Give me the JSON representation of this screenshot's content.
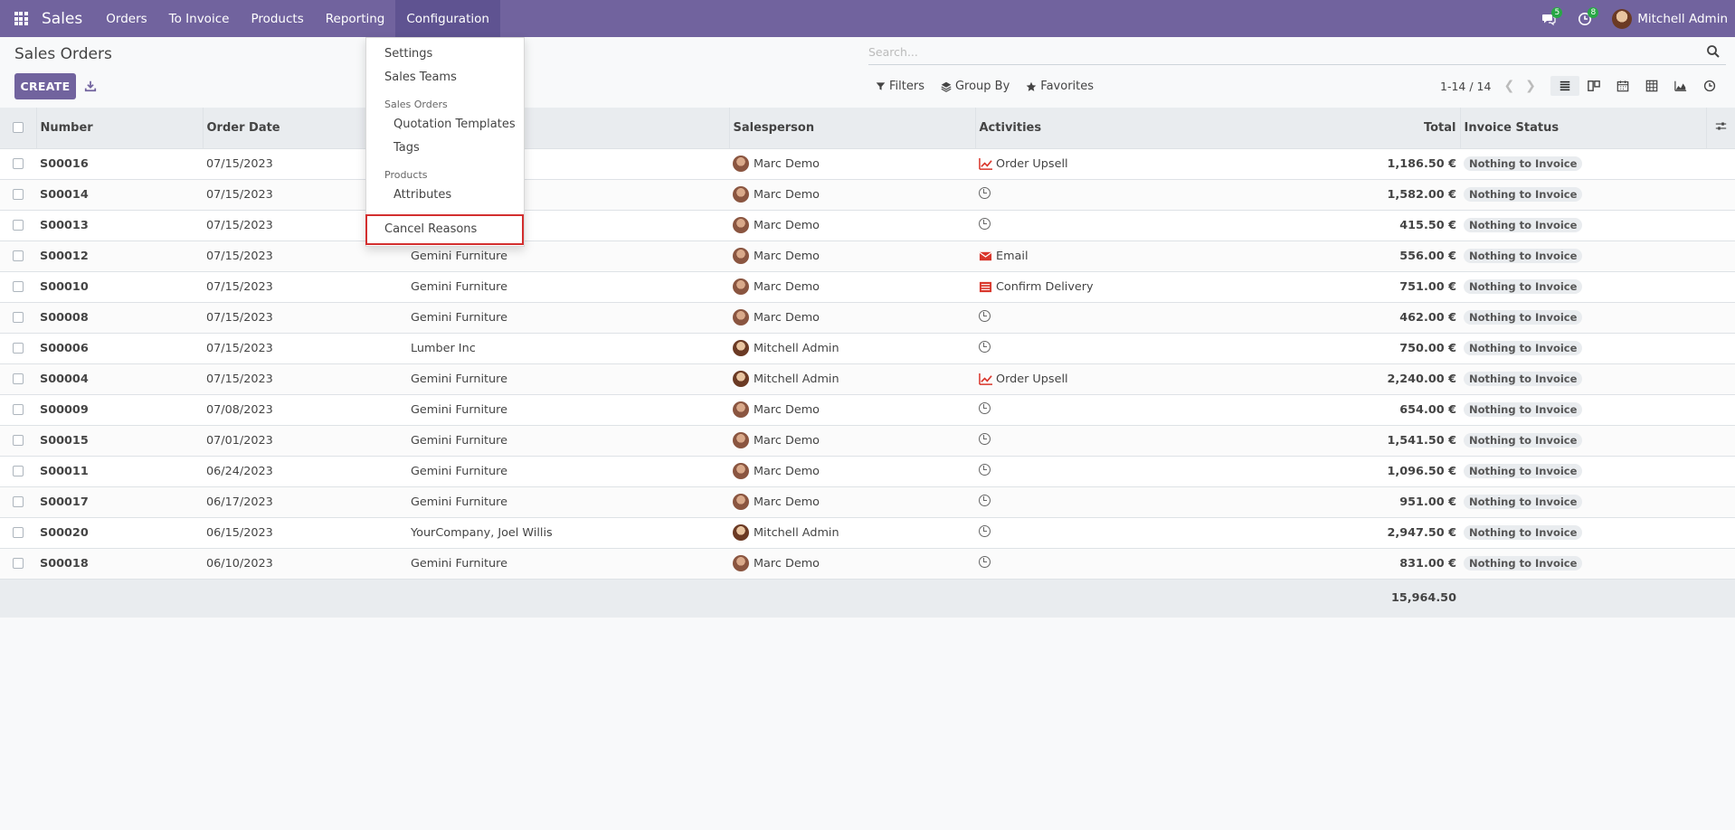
{
  "navbar": {
    "brand": "Sales",
    "menu": [
      "Orders",
      "To Invoice",
      "Products",
      "Reporting",
      "Configuration"
    ],
    "messages_count": "5",
    "activities_count": "8",
    "user_name": "Mitchell Admin"
  },
  "control_panel": {
    "title": "Sales Orders",
    "create_label": "CREATE",
    "search_placeholder": "Search...",
    "filters_label": "Filters",
    "groupby_label": "Group By",
    "favorites_label": "Favorites",
    "pager": "1-14 / 14"
  },
  "config_menu": {
    "settings": "Settings",
    "sales_teams": "Sales Teams",
    "sales_orders_header": "Sales Orders",
    "quotation_templates": "Quotation Templates",
    "tags": "Tags",
    "products_header": "Products",
    "attributes": "Attributes",
    "cancel_reasons": "Cancel Reasons"
  },
  "table": {
    "headers": {
      "number": "Number",
      "order_date": "Order Date",
      "customer": "",
      "salesperson": "Salesperson",
      "activities": "Activities",
      "total": "Total",
      "invoice_status": "Invoice Status"
    },
    "rows": [
      {
        "number": "S00016",
        "date": "07/15/2023",
        "customer": "",
        "salesperson": "Marc Demo",
        "activity": "Order Upsell",
        "activity_type": "upsell",
        "total": "1,186.50 €",
        "status": "Nothing to Invoice"
      },
      {
        "number": "S00014",
        "date": "07/15/2023",
        "customer": "",
        "salesperson": "Marc Demo",
        "activity": "",
        "activity_type": "clock",
        "total": "1,582.00 €",
        "status": "Nothing to Invoice"
      },
      {
        "number": "S00013",
        "date": "07/15/2023",
        "customer": "",
        "salesperson": "Marc Demo",
        "activity": "",
        "activity_type": "clock",
        "total": "415.50 €",
        "status": "Nothing to Invoice"
      },
      {
        "number": "S00012",
        "date": "07/15/2023",
        "customer": "Gemini Furniture",
        "salesperson": "Marc Demo",
        "activity": "Email",
        "activity_type": "email",
        "total": "556.00 €",
        "status": "Nothing to Invoice"
      },
      {
        "number": "S00010",
        "date": "07/15/2023",
        "customer": "Gemini Furniture",
        "salesperson": "Marc Demo",
        "activity": "Confirm Delivery",
        "activity_type": "delivery",
        "total": "751.00 €",
        "status": "Nothing to Invoice"
      },
      {
        "number": "S00008",
        "date": "07/15/2023",
        "customer": "Gemini Furniture",
        "salesperson": "Marc Demo",
        "activity": "",
        "activity_type": "clock",
        "total": "462.00 €",
        "status": "Nothing to Invoice"
      },
      {
        "number": "S00006",
        "date": "07/15/2023",
        "customer": "Lumber Inc",
        "salesperson": "Mitchell Admin",
        "activity": "",
        "activity_type": "clock",
        "total": "750.00 €",
        "status": "Nothing to Invoice"
      },
      {
        "number": "S00004",
        "date": "07/15/2023",
        "customer": "Gemini Furniture",
        "salesperson": "Mitchell Admin",
        "activity": "Order Upsell",
        "activity_type": "upsell",
        "total": "2,240.00 €",
        "status": "Nothing to Invoice"
      },
      {
        "number": "S00009",
        "date": "07/08/2023",
        "customer": "Gemini Furniture",
        "salesperson": "Marc Demo",
        "activity": "",
        "activity_type": "clock",
        "total": "654.00 €",
        "status": "Nothing to Invoice"
      },
      {
        "number": "S00015",
        "date": "07/01/2023",
        "customer": "Gemini Furniture",
        "salesperson": "Marc Demo",
        "activity": "",
        "activity_type": "clock",
        "total": "1,541.50 €",
        "status": "Nothing to Invoice"
      },
      {
        "number": "S00011",
        "date": "06/24/2023",
        "customer": "Gemini Furniture",
        "salesperson": "Marc Demo",
        "activity": "",
        "activity_type": "clock",
        "total": "1,096.50 €",
        "status": "Nothing to Invoice"
      },
      {
        "number": "S00017",
        "date": "06/17/2023",
        "customer": "Gemini Furniture",
        "salesperson": "Marc Demo",
        "activity": "",
        "activity_type": "clock",
        "total": "951.00 €",
        "status": "Nothing to Invoice"
      },
      {
        "number": "S00020",
        "date": "06/15/2023",
        "customer": "YourCompany, Joel Willis",
        "salesperson": "Mitchell Admin",
        "activity": "",
        "activity_type": "clock",
        "total": "2,947.50 €",
        "status": "Nothing to Invoice"
      },
      {
        "number": "S00018",
        "date": "06/10/2023",
        "customer": "Gemini Furniture",
        "salesperson": "Marc Demo",
        "activity": "",
        "activity_type": "clock",
        "total": "831.00 €",
        "status": "Nothing to Invoice"
      }
    ],
    "grand_total": "15,964.50"
  },
  "colors": {
    "brand": "#71639e",
    "activity_red": "#d9362b",
    "highlight": "#d32f2f"
  }
}
